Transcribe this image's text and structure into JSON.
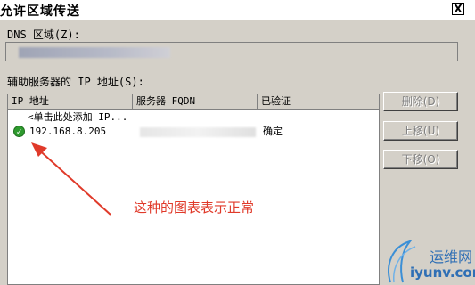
{
  "window": {
    "title": "允许区域传送",
    "close_label": "X"
  },
  "dns_zone": {
    "label": "DNS 区域(Z):",
    "value": ""
  },
  "secondary_servers": {
    "label": "辅助服务器的 IP 地址(S):",
    "columns": [
      "IP 地址",
      "服务器 FQDN",
      "已验证"
    ],
    "rows": [
      {
        "ip": "<单击此处添加 IP...",
        "fqdn": "",
        "verified": "",
        "status_icon": ""
      },
      {
        "ip": "192.168.8.205",
        "fqdn": "",
        "verified": "确定",
        "status_icon": "check-circle-icon"
      }
    ]
  },
  "buttons": {
    "delete": "删除(D)",
    "move_up": "上移(U)",
    "move_down": "下移(O)"
  },
  "annotation": {
    "text": "这种的图表表示正常",
    "color": "#e03a2a"
  },
  "watermark": {
    "line1": "运维网",
    "line2": "iyunv.com",
    "color": "#2f6fb5"
  },
  "colors": {
    "window_bg": "#d4d0c8",
    "disabled_text": "#808080",
    "ok_green": "#2e9a2e"
  }
}
